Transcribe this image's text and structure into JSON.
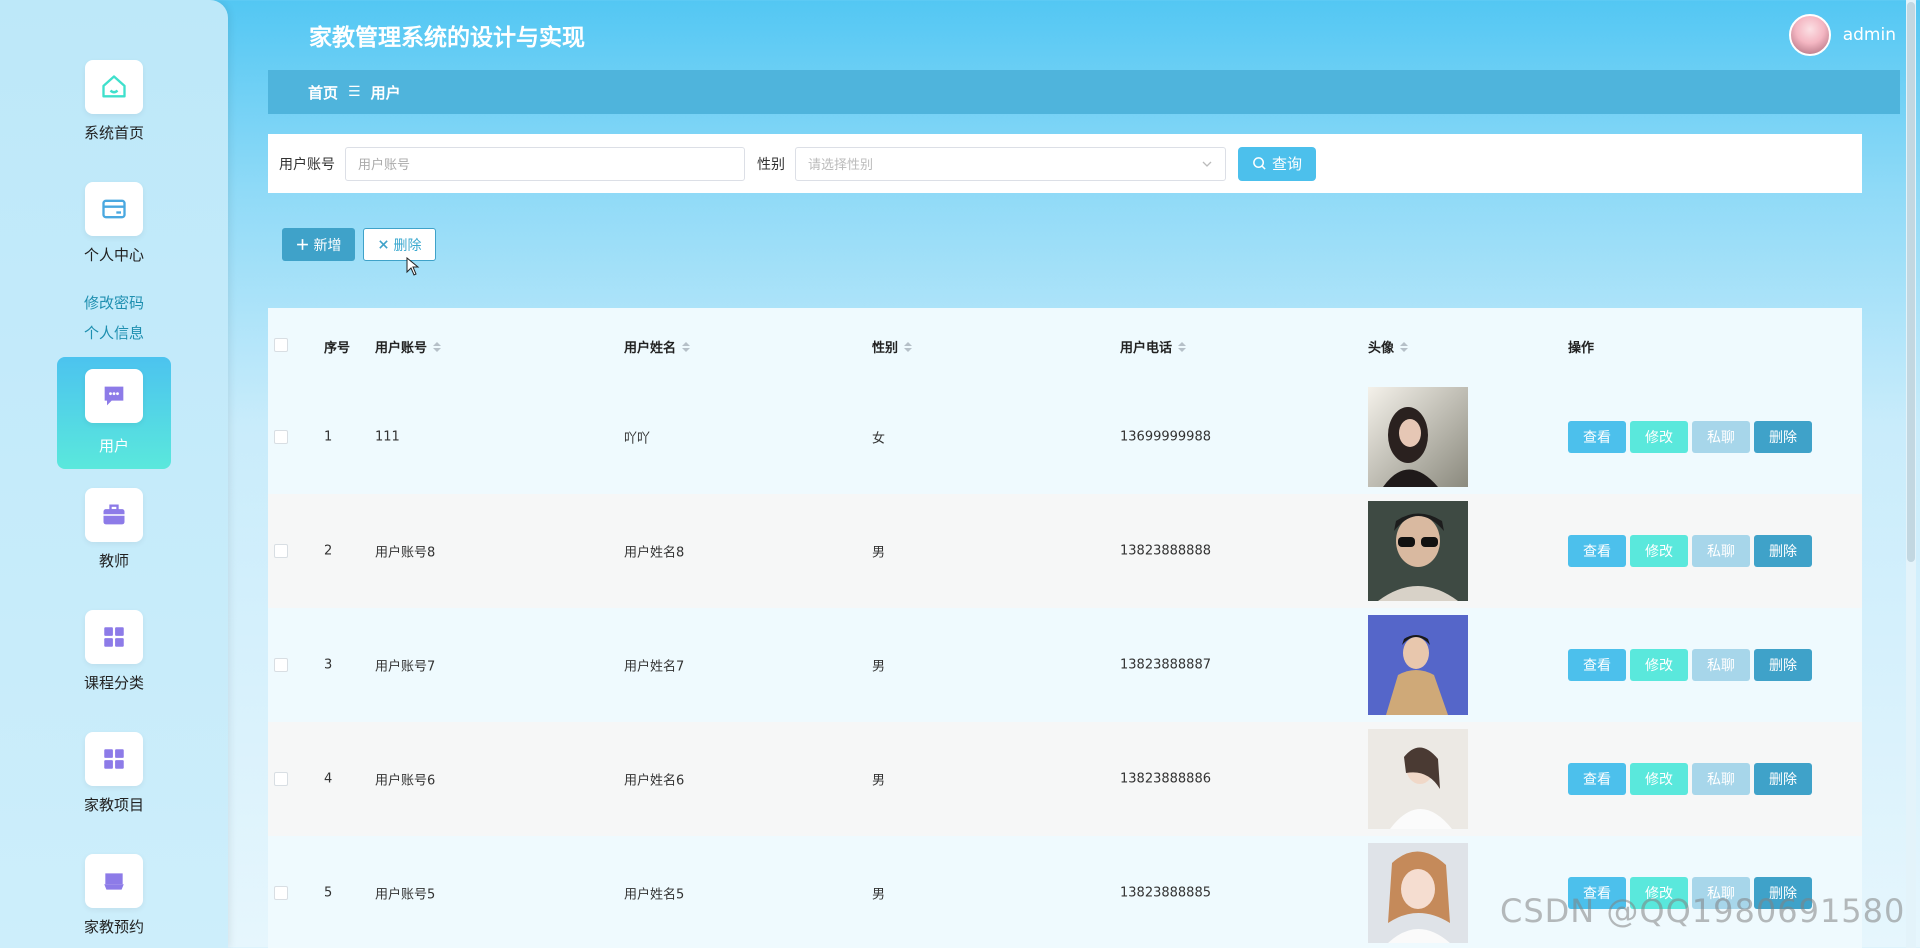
{
  "header": {
    "title": "家教管理系统的设计与实现",
    "user_name": "admin"
  },
  "breadcrumb": {
    "home": "首页",
    "separator": "☰",
    "current": "用户"
  },
  "sidebar": {
    "items": [
      {
        "label": "系统首页",
        "icon": "home-icon"
      },
      {
        "label": "个人中心",
        "icon": "wallet-icon"
      },
      {
        "label": "用户",
        "icon": "chat-icon"
      },
      {
        "label": "教师",
        "icon": "briefcase-icon"
      },
      {
        "label": "课程分类",
        "icon": "grid-icon"
      },
      {
        "label": "家教项目",
        "icon": "grid-icon"
      },
      {
        "label": "家教预约",
        "icon": "inbox-icon"
      }
    ],
    "sub_links": [
      "修改密码",
      "个人信息"
    ]
  },
  "search": {
    "account_label": "用户账号",
    "account_placeholder": "用户账号",
    "gender_label": "性别",
    "gender_placeholder": "请选择性别",
    "query_button": "查询"
  },
  "actions": {
    "add_button": "新增",
    "delete_button": "删除"
  },
  "table": {
    "columns": [
      "序号",
      "用户账号",
      "用户姓名",
      "性别",
      "用户电话",
      "头像",
      "操作"
    ],
    "row_buttons": {
      "view": "查看",
      "edit": "修改",
      "chat": "私聊",
      "delete": "删除"
    },
    "rows": [
      {
        "index": "1",
        "account": "111",
        "name": "吖吖",
        "gender": "女",
        "phone": "13699999988"
      },
      {
        "index": "2",
        "account": "用户账号8",
        "name": "用户姓名8",
        "gender": "男",
        "phone": "13823888888"
      },
      {
        "index": "3",
        "account": "用户账号7",
        "name": "用户姓名7",
        "gender": "男",
        "phone": "13823888887"
      },
      {
        "index": "4",
        "account": "用户账号6",
        "name": "用户姓名6",
        "gender": "男",
        "phone": "13823888886"
      },
      {
        "index": "5",
        "account": "用户账号5",
        "name": "用户姓名5",
        "gender": "男",
        "phone": "13823888885"
      }
    ]
  },
  "watermark": "CSDN @QQ1980691580",
  "colors": {
    "primary": "#4cc0ec",
    "accent": "#5ae8dc",
    "dark": "#3fa2c9"
  }
}
